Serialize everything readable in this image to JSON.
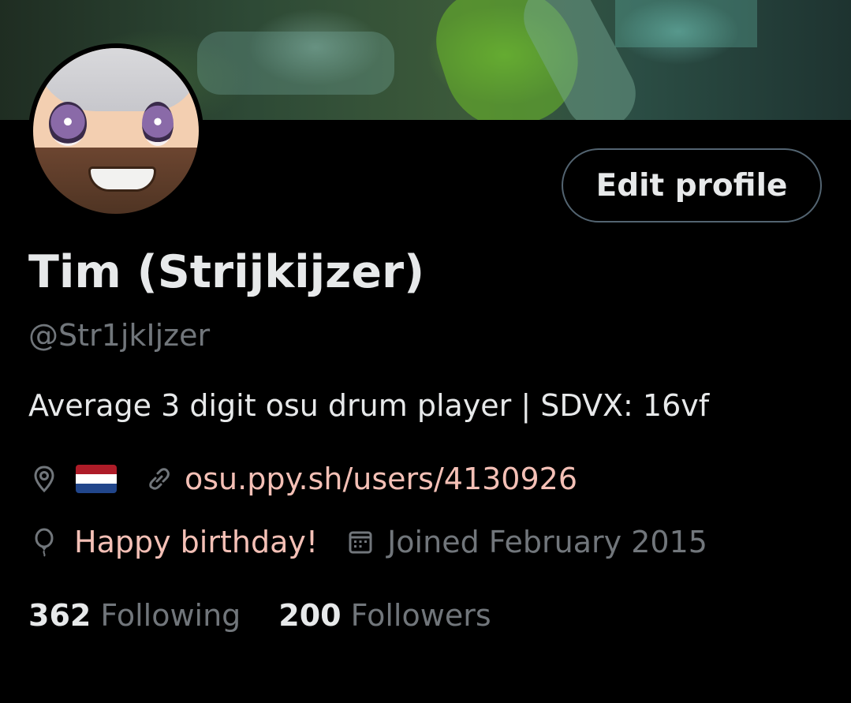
{
  "profile": {
    "display_name": "Tim (Strijkijzer)",
    "handle": "@Str1jkIjzer",
    "bio": "Average 3 digit osu drum player | SDVX: 16vf",
    "location_flag": "Netherlands flag",
    "website": "osu.ppy.sh/users/4130926",
    "birthday_text": "Happy birthday!",
    "joined": "Joined February 2015"
  },
  "actions": {
    "edit_profile": "Edit profile"
  },
  "stats": {
    "following_count": "362",
    "following_label": "Following",
    "followers_count": "200",
    "followers_label": "Followers"
  },
  "colors": {
    "background": "#000000",
    "text_primary": "#e7e9ea",
    "text_secondary": "#71767b",
    "accent": "#f4c0b6",
    "border": "#536471"
  },
  "icons": [
    "location-icon",
    "link-icon",
    "balloon-icon",
    "calendar-icon"
  ]
}
